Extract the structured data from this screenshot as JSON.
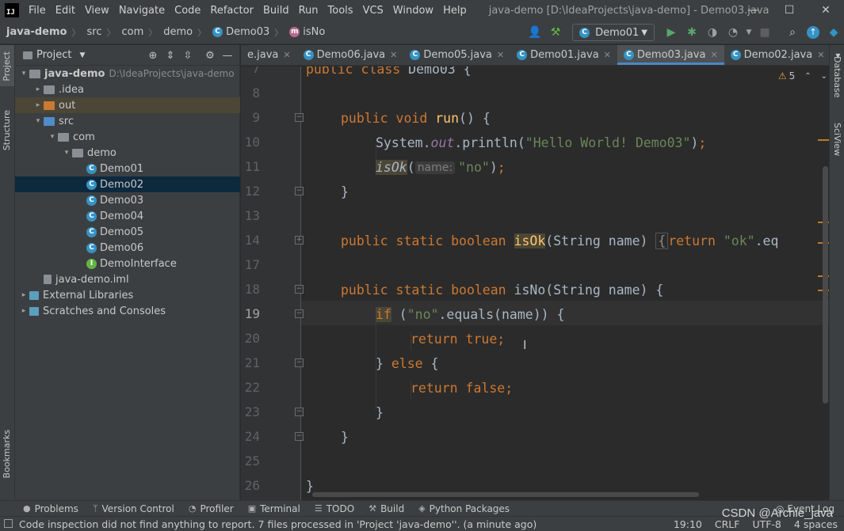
{
  "menubar": {
    "logo": "IJ",
    "items": [
      "File",
      "Edit",
      "View",
      "Navigate",
      "Code",
      "Refactor",
      "Build",
      "Run",
      "Tools",
      "VCS",
      "Window",
      "Help"
    ],
    "title": "java-demo [D:\\IdeaProjects\\java-demo] - Demo03.java",
    "minimize": "—",
    "maximize": "☐",
    "close": "✕"
  },
  "breadcrumbs": [
    "java-demo",
    "src",
    "com",
    "demo",
    "Demo03",
    "isNo"
  ],
  "toolbar": {
    "run_config": "Demo01"
  },
  "side": {
    "project": "Project",
    "structure": "Structure",
    "bookmarks": "Bookmarks",
    "database": "Database",
    "sciview": "SciView"
  },
  "project": {
    "header": "Project",
    "root": {
      "name": "java-demo",
      "path": "D:\\IdeaProjects\\java-demo"
    },
    "tree": [
      {
        "label": ".idea",
        "depth": 1,
        "type": "folder-gray",
        "arrow": "▸"
      },
      {
        "label": "out",
        "depth": 1,
        "type": "folder-orange",
        "arrow": "▸"
      },
      {
        "label": "src",
        "depth": 1,
        "type": "folder-blue",
        "arrow": "▾"
      },
      {
        "label": "com",
        "depth": 2,
        "type": "folder-gray",
        "arrow": "▾"
      },
      {
        "label": "demo",
        "depth": 3,
        "type": "folder-gray",
        "arrow": "▾"
      },
      {
        "label": "Demo01",
        "depth": 4,
        "type": "class"
      },
      {
        "label": "Demo02",
        "depth": 4,
        "type": "class",
        "selected": true
      },
      {
        "label": "Demo03",
        "depth": 4,
        "type": "class"
      },
      {
        "label": "Demo04",
        "depth": 4,
        "type": "class"
      },
      {
        "label": "Demo05",
        "depth": 4,
        "type": "class"
      },
      {
        "label": "Demo06",
        "depth": 4,
        "type": "class"
      },
      {
        "label": "DemoInterface",
        "depth": 4,
        "type": "interface"
      },
      {
        "label": "java-demo.iml",
        "depth": 1,
        "type": "file"
      },
      {
        "label": "External Libraries",
        "depth": 0,
        "type": "lib",
        "arrow": "▸"
      },
      {
        "label": "Scratches and Consoles",
        "depth": 0,
        "type": "scratch",
        "arrow": "▸"
      }
    ]
  },
  "tabs": [
    {
      "label": "e.java",
      "active": false
    },
    {
      "label": "Demo06.java",
      "active": false
    },
    {
      "label": "Demo05.java",
      "active": false
    },
    {
      "label": "Demo01.java",
      "active": false
    },
    {
      "label": "Demo03.java",
      "active": true
    },
    {
      "label": "Demo02.java",
      "active": false
    }
  ],
  "editor": {
    "inspection_count": "5",
    "inlay_hint": "name:",
    "line_numbers": [
      "7",
      "8",
      "9",
      "10",
      "11",
      "12",
      "13",
      "14",
      "17",
      "18",
      "19",
      "20",
      "21",
      "22",
      "23",
      "24",
      "25",
      "26"
    ],
    "current_line": "19"
  },
  "toolwindows": [
    "Problems",
    "Version Control",
    "Profiler",
    "Terminal",
    "TODO",
    "Build",
    "Python Packages"
  ],
  "event_log": "Event Log",
  "status": {
    "message": "Code inspection did not find anything to report. 7 files processed in 'Project 'java-demo''. (a minute ago)",
    "position": "19:10",
    "line_sep": "CRLF",
    "encoding": "UTF-8",
    "indent": "4 spaces"
  },
  "watermark": "CSDN @Archie_java"
}
